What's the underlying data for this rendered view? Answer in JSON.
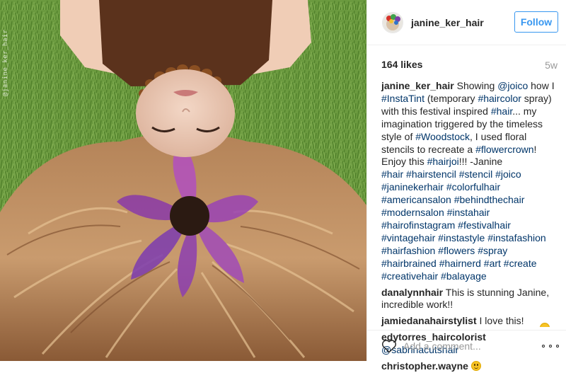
{
  "post": {
    "watermark": "@janine_ker_hair",
    "author": {
      "username": "janine_ker_hair",
      "follow_label": "Follow"
    },
    "likes": "164 likes",
    "age": "5w",
    "caption": {
      "user": "janine_ker_hair",
      "segments": [
        {
          "t": " Showing ",
          "tag": false
        },
        {
          "t": "@joico",
          "tag": true
        },
        {
          "t": " how I ",
          "tag": false
        },
        {
          "t": "#InstaTint",
          "tag": true
        },
        {
          "t": " (temporary ",
          "tag": false
        },
        {
          "t": "#haircolor",
          "tag": true
        },
        {
          "t": " spray) with this festival inspired ",
          "tag": false
        },
        {
          "t": "#hair",
          "tag": true
        },
        {
          "t": "... my imagination triggered by the timeless style of ",
          "tag": false
        },
        {
          "t": "#Woodstock",
          "tag": true
        },
        {
          "t": ", I used floral stencils to recreate a ",
          "tag": false
        },
        {
          "t": "#flowercrown",
          "tag": true
        },
        {
          "t": "! Enjoy this ",
          "tag": false
        },
        {
          "t": "#hairjoi",
          "tag": true
        },
        {
          "t": "!!! -Janine",
          "tag": false
        },
        {
          "br": true
        },
        {
          "t": "#hair",
          "tag": true
        },
        {
          "t": " ",
          "tag": false
        },
        {
          "t": "#hairstencil",
          "tag": true
        },
        {
          "t": " ",
          "tag": false
        },
        {
          "t": "#stencil",
          "tag": true
        },
        {
          "t": " ",
          "tag": false
        },
        {
          "t": "#joico",
          "tag": true
        },
        {
          "t": " ",
          "tag": false
        },
        {
          "t": "#janinekerhair",
          "tag": true
        },
        {
          "t": " ",
          "tag": false
        },
        {
          "t": "#colorfulhair",
          "tag": true
        },
        {
          "t": " ",
          "tag": false
        },
        {
          "t": "#americansalon",
          "tag": true
        },
        {
          "t": " ",
          "tag": false
        },
        {
          "t": "#behindthechair",
          "tag": true
        },
        {
          "t": " ",
          "tag": false
        },
        {
          "t": "#modernsalon",
          "tag": true
        },
        {
          "t": " ",
          "tag": false
        },
        {
          "t": "#instahair",
          "tag": true
        },
        {
          "t": " ",
          "tag": false
        },
        {
          "t": "#hairofinstagram",
          "tag": true
        },
        {
          "t": " ",
          "tag": false
        },
        {
          "t": "#festivalhair",
          "tag": true
        },
        {
          "t": " ",
          "tag": false
        },
        {
          "t": "#vintagehair",
          "tag": true
        },
        {
          "t": " ",
          "tag": false
        },
        {
          "t": "#instastyle",
          "tag": true
        },
        {
          "t": " ",
          "tag": false
        },
        {
          "t": "#instafashion",
          "tag": true
        },
        {
          "t": " ",
          "tag": false
        },
        {
          "t": "#hairfashion",
          "tag": true
        },
        {
          "t": " ",
          "tag": false
        },
        {
          "t": "#flowers",
          "tag": true
        },
        {
          "t": " ",
          "tag": false
        },
        {
          "t": "#spray",
          "tag": true
        },
        {
          "t": " ",
          "tag": false
        },
        {
          "t": "#hairbrained",
          "tag": true
        },
        {
          "t": " ",
          "tag": false
        },
        {
          "t": "#hairnerd",
          "tag": true
        },
        {
          "t": " ",
          "tag": false
        },
        {
          "t": "#art",
          "tag": true
        },
        {
          "t": " ",
          "tag": false
        },
        {
          "t": "#create",
          "tag": true
        },
        {
          "t": " ",
          "tag": false
        },
        {
          "t": "#creativehair",
          "tag": true
        },
        {
          "t": " ",
          "tag": false
        },
        {
          "t": "#balayage",
          "tag": true
        }
      ]
    },
    "comments": [
      {
        "user": "danalynnhair",
        "segments": [
          {
            "t": " This is stunning Janine, incredible work!!",
            "tag": false
          }
        ]
      },
      {
        "user": "jamiedanahairstylist",
        "segments": [
          {
            "t": " I love this!",
            "tag": false
          }
        ]
      },
      {
        "user": "edytorres_haircolorist",
        "segments": [
          {
            "t": " ",
            "tag": false
          },
          {
            "t": "@sabrinacutshair",
            "tag": true
          }
        ]
      },
      {
        "user": "christopher.wayne",
        "segments": [
          {
            "t": " ",
            "tag": false
          }
        ],
        "emoji": "smiling-face-emoji"
      }
    ],
    "add_comment_placeholder": "Add a comment...",
    "colors": {
      "link": "#003569",
      "follow": "#3897f0",
      "muted": "#999999",
      "text": "#262626"
    },
    "icons": {
      "like": "heart-icon",
      "options": "more-options-icon"
    }
  }
}
